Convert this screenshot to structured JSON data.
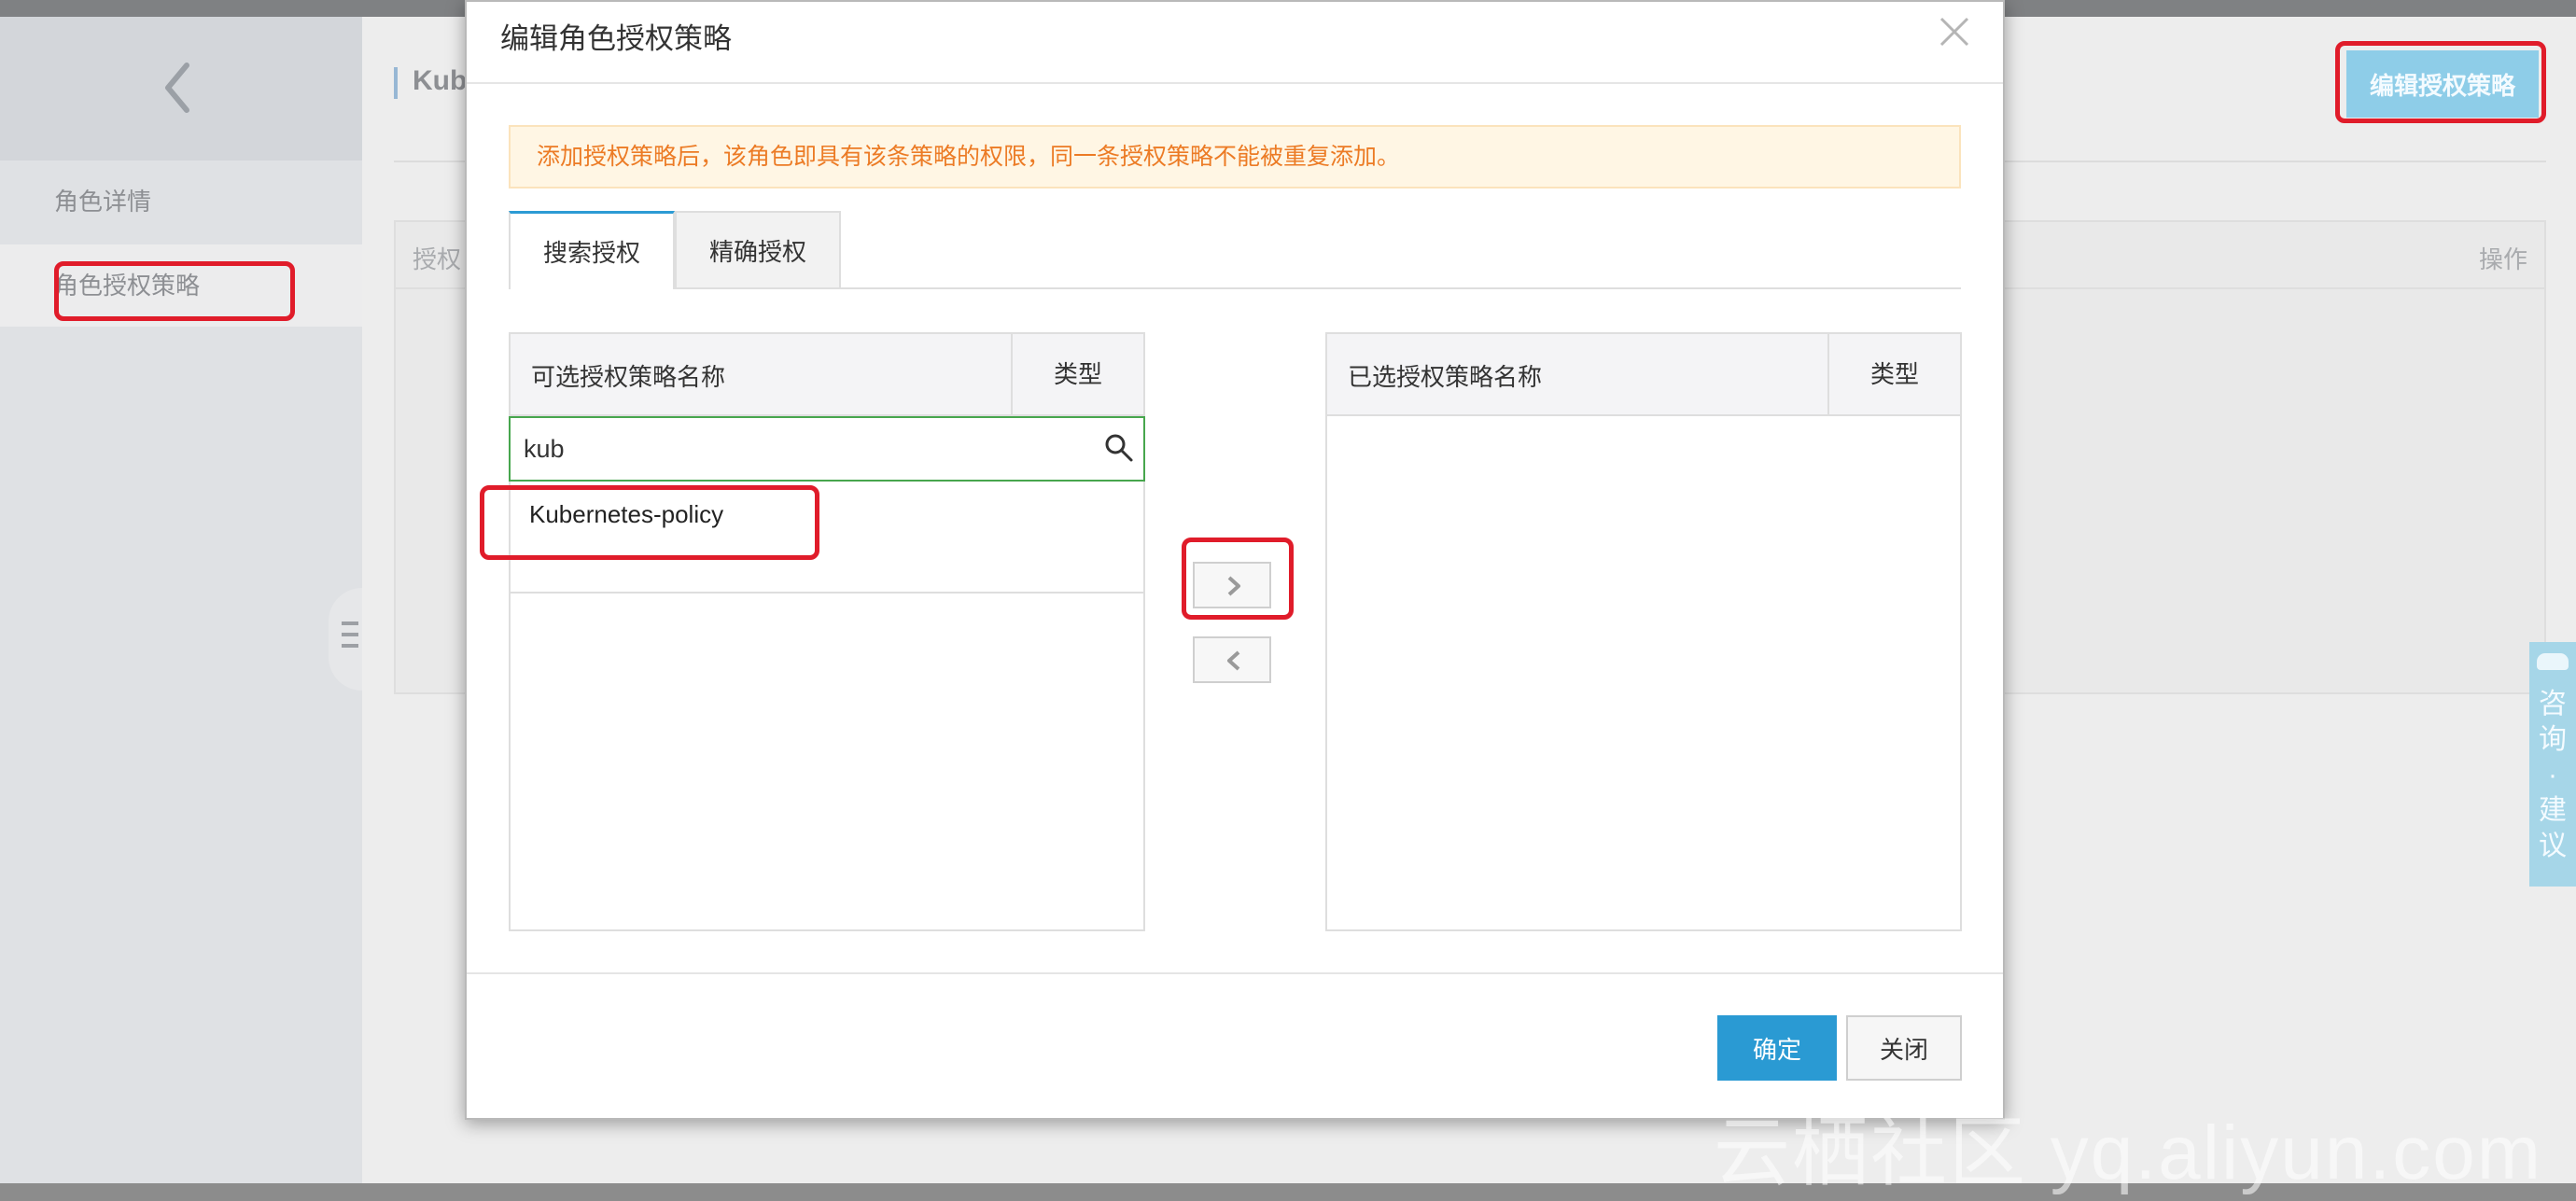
{
  "sidebar": {
    "items": [
      {
        "label": "角色详情"
      },
      {
        "label": "角色授权策略"
      }
    ]
  },
  "main": {
    "title": "Kub",
    "edit_button": "编辑授权策略",
    "table": {
      "col_left": "授权",
      "col_right": "操作"
    }
  },
  "modal": {
    "title": "编辑角色授权策略",
    "notice": "添加授权策略后，该角色即具有该条策略的权限，同一条授权策略不能被重复添加。",
    "tabs": [
      {
        "label": "搜索授权",
        "active": true
      },
      {
        "label": "精确授权",
        "active": false
      }
    ],
    "available": {
      "header_name": "可选授权策略名称",
      "header_type": "类型",
      "search_value": "kub",
      "results": [
        "Kubernetes-policy"
      ]
    },
    "selected": {
      "header_name": "已选授权策略名称",
      "header_type": "类型"
    },
    "buttons": {
      "ok": "确定",
      "close": "关闭"
    }
  },
  "consult": {
    "label": "咨询·建议"
  },
  "watermark": "云栖社区 yq.aliyun.com",
  "colors": {
    "accent": "#2a9ad3",
    "highlight": "#e01c2a",
    "notice": "#ec7b25"
  }
}
